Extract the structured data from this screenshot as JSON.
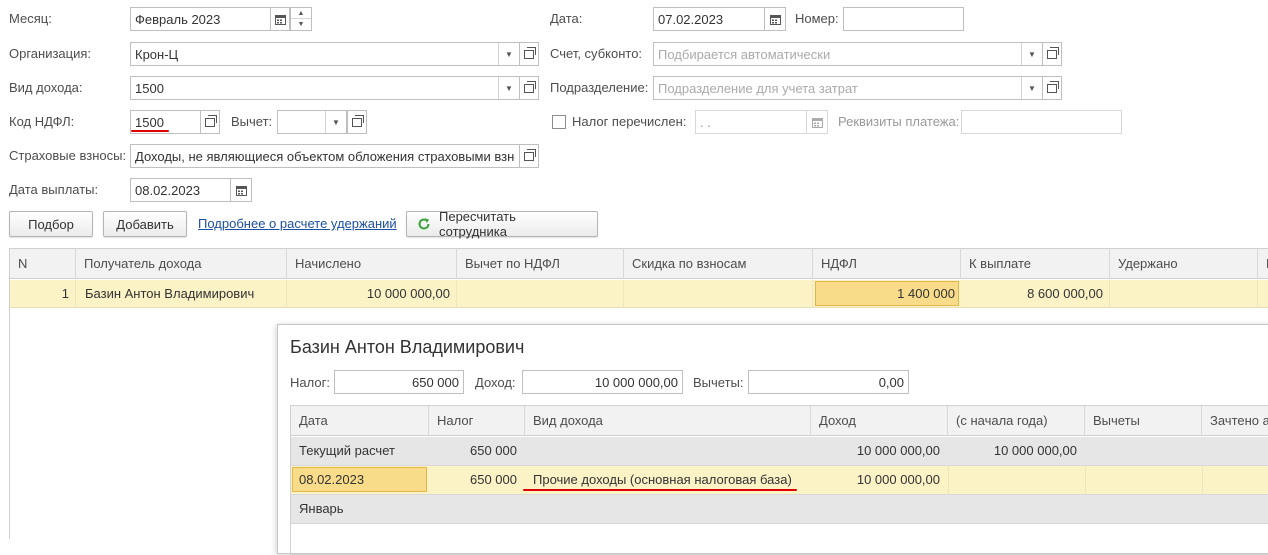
{
  "form": {
    "month_label": "Месяц:",
    "month_value": "Февраль 2023",
    "org_label": "Организация:",
    "org_value": "Крон-Ц",
    "income_type_label": "Вид дохода:",
    "income_type_value": "1500",
    "ndfl_code_label": "Код НДФЛ:",
    "ndfl_code_value": "1500",
    "deduction_label": "Вычет:",
    "deduction_value": "",
    "insurance_label": "Страховые взносы:",
    "insurance_value": "Доходы, не являющиеся объектом обложения страховыми взно",
    "pay_date_label": "Дата выплаты:",
    "pay_date_value": "08.02.2023",
    "date_label": "Дата:",
    "date_value": "07.02.2023",
    "number_label": "Номер:",
    "number_value": "",
    "account_label": "Счет, субконто:",
    "account_placeholder": "Подбирается автоматически",
    "dept_label": "Подразделение:",
    "dept_placeholder": "Подразделение для учета затрат",
    "tax_paid_label": "Налог перечислен:",
    "tax_paid_date": " .  .",
    "payment_details_label": "Реквизиты платежа:",
    "payment_details_value": ""
  },
  "toolbar": {
    "select_label": "Подбор",
    "add_label": "Добавить",
    "details_link": "Подробнее о расчете удержаний",
    "recalc_label": "Пересчитать сотрудника"
  },
  "table": {
    "headers": [
      "N",
      "Получатель дохода",
      "Начислено",
      "Вычет по НДФЛ",
      "Скидка по взносам",
      "НДФЛ",
      "К выплате",
      "Удержано",
      "В"
    ],
    "row": {
      "n": "1",
      "recipient": "Базин Антон Владимирович",
      "accrued": "10 000 000,00",
      "ndfl_deduction": "",
      "discount": "",
      "ndfl": "1 400 000",
      "to_pay": "8 600 000,00",
      "withheld": ""
    }
  },
  "popup": {
    "title": "Базин Антон Владимирович",
    "tax_label": "Налог:",
    "tax_value": "650 000",
    "income_label": "Доход:",
    "income_value": "10 000 000,00",
    "deductions_label": "Вычеты:",
    "deductions_value": "0,00",
    "headers": [
      "Дата",
      "Налог",
      "Вид дохода",
      "Доход",
      "(с начала года)",
      "Вычеты",
      "Зачтено а"
    ],
    "row_current": {
      "date": "Текущий расчет",
      "tax": "650 000",
      "income": "10 000 000,00",
      "ytd": "10 000 000,00"
    },
    "row_detail": {
      "date": "08.02.2023",
      "tax": "650 000",
      "type": "Прочие доходы (основная налоговая база)",
      "income": "10 000 000,00"
    },
    "row_january": "Январь"
  },
  "colors": {
    "accent_red": "#e00000",
    "link_blue": "#1c4fa6",
    "row_highlight": "#fbf2c6",
    "cell_selected": "#f9dc8a",
    "recalc_icon": "#3aa33a"
  }
}
